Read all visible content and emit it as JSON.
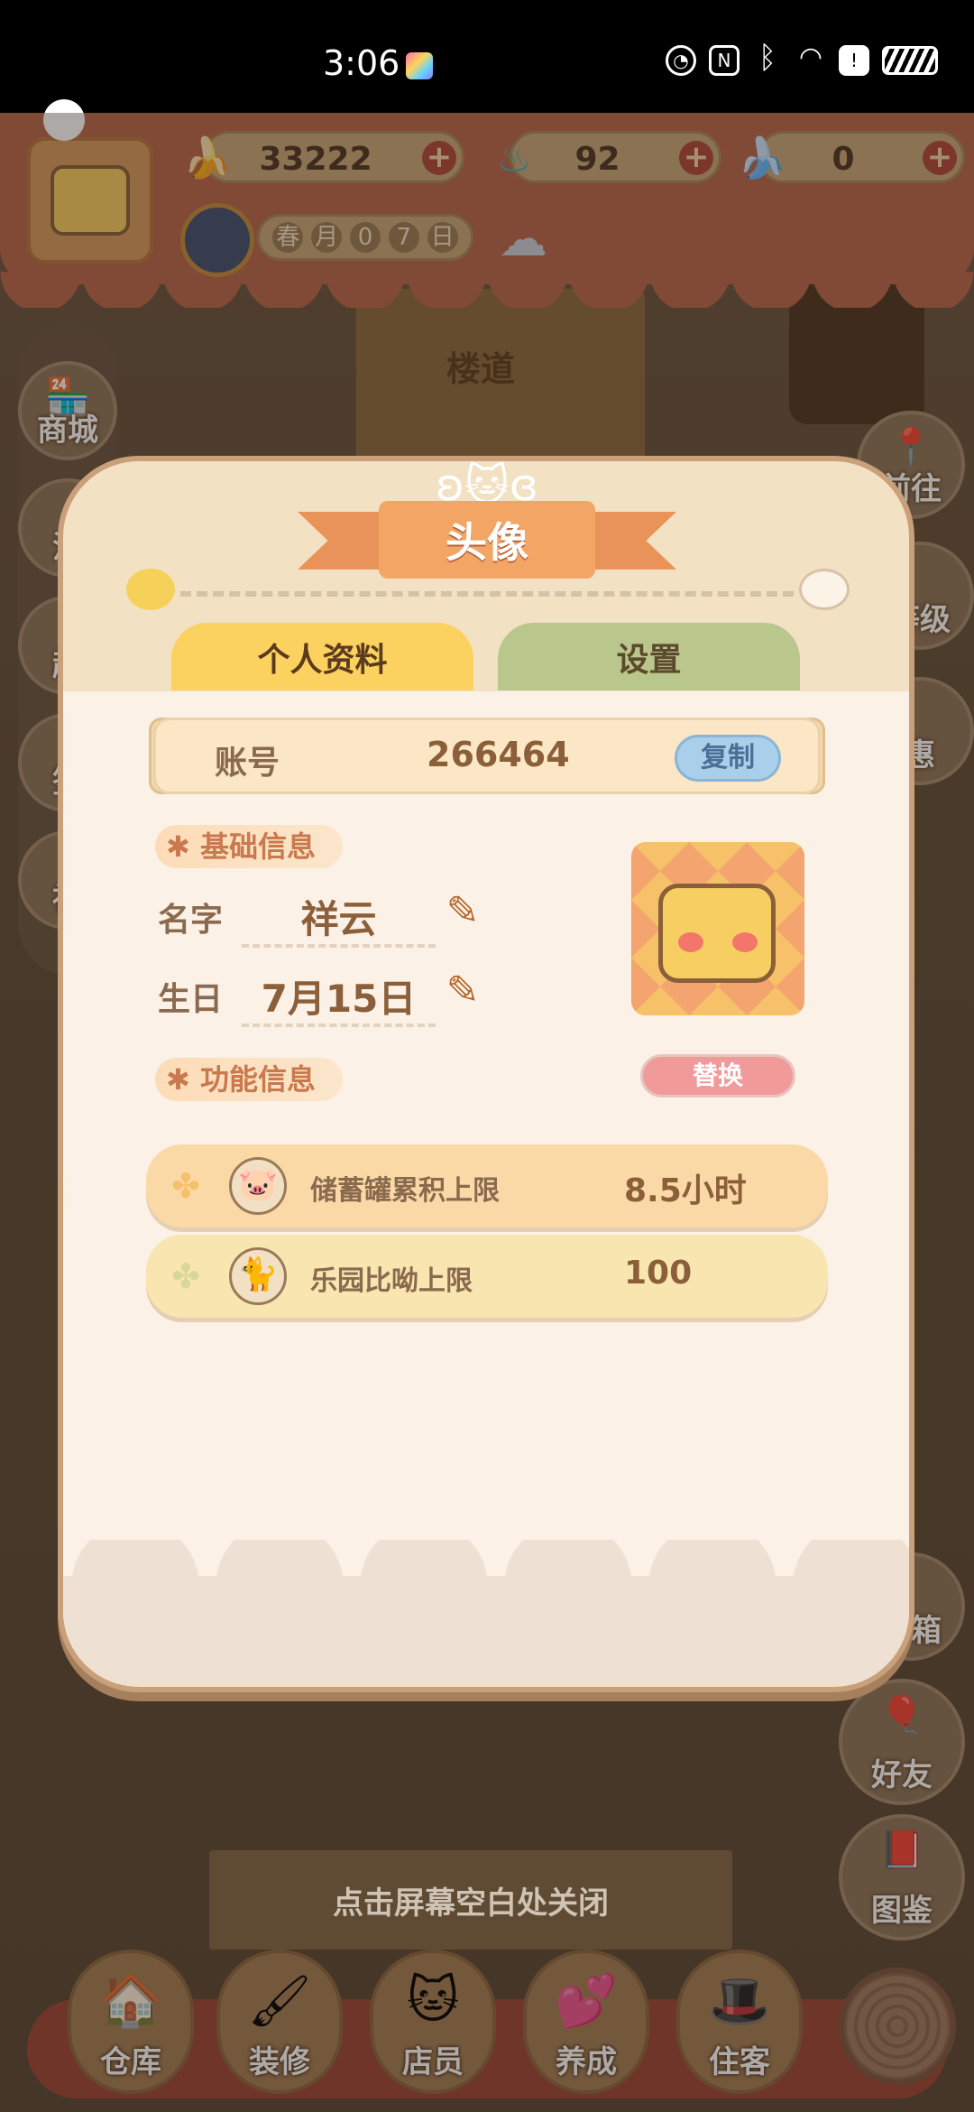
{
  "status_bar": {
    "time": "3:06"
  },
  "hud": {
    "bananas": "33222",
    "flames": "92",
    "blue_bananas": "0",
    "season": [
      "春",
      "月",
      "0",
      "7",
      "日"
    ]
  },
  "scene": {
    "hall_sign": "楼道"
  },
  "side_menu_left": [
    "商城",
    "活",
    "超",
    "签",
    "社"
  ],
  "side_menu_right": [
    "前往",
    "等级",
    "惠",
    "宝箱",
    "好友",
    "图鉴"
  ],
  "modal": {
    "title": "头像",
    "tabs": [
      "个人资料",
      "设置"
    ],
    "account": {
      "label": "账号",
      "value": "266464",
      "copy": "复制"
    },
    "basic_section": "基础信息",
    "name_label": "名字",
    "name_value": "祥云",
    "birthday_label": "生日",
    "birthday_value": "7月15日",
    "replace": "替换",
    "function_section": "功能信息",
    "stats": [
      {
        "label": "储蓄罐累积上限",
        "value": "8.5小时"
      },
      {
        "label": "乐园比呦上限",
        "value": "100"
      }
    ]
  },
  "close_tip": "点击屏幕空白处关闭",
  "bottom_nav": [
    "仓库",
    "装修",
    "店员",
    "养成",
    "住客"
  ]
}
